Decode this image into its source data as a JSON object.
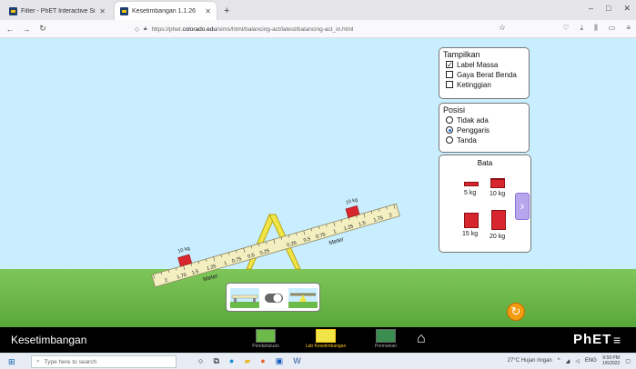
{
  "browser": {
    "tabs": [
      {
        "title": "Filter - PhET Interactive Simulati",
        "active": false
      },
      {
        "title": "Kesetimbangan 1.1.26",
        "active": true
      }
    ],
    "new_tab": "+",
    "url_prefix": "https://phet.",
    "url_domain": "colorado.edu",
    "url_path": "/sims/html/balancing-act/latest/balancing-act_in.html",
    "window_controls": [
      "–",
      "□",
      "✕"
    ]
  },
  "sim": {
    "show_panel": {
      "title": "Tampilkan",
      "items": [
        {
          "label": "Label Massa",
          "checked": true
        },
        {
          "label": "Gaya Berat Benda",
          "checked": false
        },
        {
          "label": "Ketinggian",
          "checked": false
        }
      ]
    },
    "position_panel": {
      "title": "Posisi",
      "items": [
        {
          "label": "Tidak ada",
          "selected": false
        },
        {
          "label": "Penggaris",
          "selected": true
        },
        {
          "label": "Tanda",
          "selected": false
        }
      ]
    },
    "bricks_panel": {
      "title": "Bata",
      "items": [
        {
          "label": "5 kg"
        },
        {
          "label": "10 kg"
        },
        {
          "label": "15 kg"
        },
        {
          "label": "20 kg"
        }
      ]
    },
    "plank": {
      "left_mass_label": "10 kg",
      "right_mass_label": "10 kg",
      "left_ruler_caption": "Meter",
      "right_ruler_caption": "Meter",
      "left_ticks": [
        "2",
        "1.75",
        "1.5",
        "1.25",
        "1",
        "0.75",
        "0.5",
        "0.25"
      ],
      "right_ticks": [
        "0.25",
        "0.5",
        "0.75",
        "1",
        "1.25",
        "1.5",
        "1.75",
        "2"
      ]
    }
  },
  "phet_nav": {
    "app_name": "Kesetimbangan",
    "screens": [
      {
        "label": "Pendahuluan",
        "active": false
      },
      {
        "label": "Lab Kesetimbangan",
        "active": true
      },
      {
        "label": "Permainan",
        "active": false
      }
    ],
    "logo": "PhET"
  },
  "taskbar": {
    "search_placeholder": "Type here to search",
    "weather": "27°C  Hujan ringan",
    "lang": "ENG",
    "time": "9:59 PM",
    "date": "1/6/2022"
  },
  "colors": {
    "sky": "#c9eeff",
    "grass": "#6cba4a",
    "brick": "#d7262d",
    "plank": "#f3efc0",
    "fulcrum": "#f1e447",
    "arrow_button": "#b7a6ee",
    "reset": "#f39c12"
  }
}
